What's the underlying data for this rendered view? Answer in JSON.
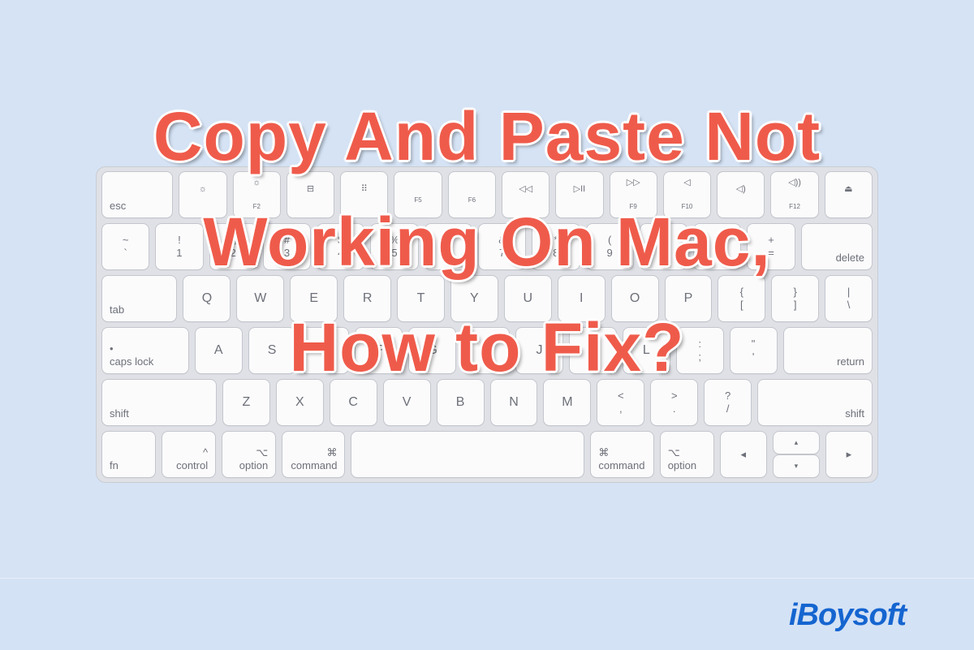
{
  "title": {
    "lines": [
      "Copy And Paste Not",
      "Working On Mac,",
      "How to Fix?"
    ],
    "color": "#ef5b4b"
  },
  "logo": {
    "text": "iBoysoft",
    "color": "#1565d0"
  },
  "background_color": "#d5e3f5",
  "keyboard": {
    "rows": [
      [
        {
          "t": "",
          "b": "esc",
          "cls": "left",
          "w": 1.35
        },
        {
          "t": "☼",
          "b": "",
          "cls": "fn"
        },
        {
          "t": "☼",
          "b": "F2",
          "cls": "fn"
        },
        {
          "t": "⊟",
          "b": "",
          "cls": "fn"
        },
        {
          "t": "⠿",
          "b": "",
          "cls": "fn"
        },
        {
          "t": "",
          "b": "F5",
          "cls": "fn"
        },
        {
          "t": "",
          "b": "F6",
          "cls": "fn"
        },
        {
          "t": "◁◁",
          "b": "",
          "cls": "fn"
        },
        {
          "t": "▷II",
          "b": "",
          "cls": "fn"
        },
        {
          "t": "▷▷",
          "b": "F9",
          "cls": "fn"
        },
        {
          "t": "◁",
          "b": "F10",
          "cls": "fn"
        },
        {
          "t": "◁)",
          "b": "",
          "cls": "fn"
        },
        {
          "t": "◁))",
          "b": "F12",
          "cls": "fn"
        },
        {
          "t": "⏏",
          "b": "",
          "cls": "fn"
        }
      ],
      [
        {
          "t": "~",
          "b": "`"
        },
        {
          "t": "!",
          "b": "1"
        },
        {
          "t": "@",
          "b": "2"
        },
        {
          "t": "#",
          "b": "3"
        },
        {
          "t": "$",
          "b": "4"
        },
        {
          "t": "%",
          "b": "5"
        },
        {
          "t": "^",
          "b": "6"
        },
        {
          "t": "&",
          "b": "7"
        },
        {
          "t": "*",
          "b": "8"
        },
        {
          "t": "(",
          "b": "9"
        },
        {
          "t": ")",
          "b": "0"
        },
        {
          "t": "_",
          "b": "-"
        },
        {
          "t": "+",
          "b": "="
        },
        {
          "t": "",
          "b": "delete",
          "cls": "right",
          "w": 1.35
        }
      ],
      [
        {
          "t": "",
          "b": "tab",
          "cls": "left",
          "w": 1.45
        },
        {
          "t": "Q",
          "cls": "big"
        },
        {
          "t": "W",
          "cls": "big"
        },
        {
          "t": "E",
          "cls": "big"
        },
        {
          "t": "R",
          "cls": "big"
        },
        {
          "t": "T",
          "cls": "big"
        },
        {
          "t": "Y",
          "cls": "big"
        },
        {
          "t": "U",
          "cls": "big"
        },
        {
          "t": "I",
          "cls": "big"
        },
        {
          "t": "O",
          "cls": "big"
        },
        {
          "t": "P",
          "cls": "big"
        },
        {
          "t": "{",
          "b": "["
        },
        {
          "t": "}",
          "b": "]"
        },
        {
          "t": "|",
          "b": "\\"
        }
      ],
      [
        {
          "t": "•",
          "b": "caps lock",
          "cls": "left",
          "w": 1.7
        },
        {
          "t": "A",
          "cls": "big"
        },
        {
          "t": "S",
          "cls": "big"
        },
        {
          "t": "D",
          "cls": "big"
        },
        {
          "t": "F",
          "cls": "big"
        },
        {
          "t": "G",
          "cls": "big"
        },
        {
          "t": "H",
          "cls": "big"
        },
        {
          "t": "J",
          "cls": "big"
        },
        {
          "t": "K",
          "cls": "big"
        },
        {
          "t": "L",
          "cls": "big"
        },
        {
          "t": ":",
          "b": ";"
        },
        {
          "t": "\"",
          "b": "'"
        },
        {
          "t": "",
          "b": "return",
          "cls": "right",
          "w": 1.75
        }
      ],
      [
        {
          "t": "",
          "b": "shift",
          "cls": "left",
          "w": 2.3
        },
        {
          "t": "Z",
          "cls": "big"
        },
        {
          "t": "X",
          "cls": "big"
        },
        {
          "t": "C",
          "cls": "big"
        },
        {
          "t": "V",
          "cls": "big"
        },
        {
          "t": "B",
          "cls": "big"
        },
        {
          "t": "N",
          "cls": "big"
        },
        {
          "t": "M",
          "cls": "big"
        },
        {
          "t": "<",
          "b": ","
        },
        {
          "t": ">",
          "b": "."
        },
        {
          "t": "?",
          "b": "/"
        },
        {
          "t": "",
          "b": "shift",
          "cls": "right",
          "w": 2.3
        }
      ],
      [
        {
          "t": "",
          "b": "fn",
          "cls": "left"
        },
        {
          "t": "^",
          "b": "control",
          "cls": "right"
        },
        {
          "t": "⌥",
          "b": "option",
          "cls": "right"
        },
        {
          "t": "⌘",
          "b": "command",
          "cls": "right",
          "w": 1.2
        },
        {
          "t": "",
          "b": "",
          "w": 5.1
        },
        {
          "t": "⌘",
          "b": "command",
          "cls": "left",
          "w": 1.2
        },
        {
          "t": "⌥",
          "b": "option",
          "cls": "left"
        },
        {
          "t": "◂",
          "b": ""
        },
        {
          "arrows": [
            "▴",
            "▾"
          ]
        },
        {
          "t": "▸",
          "b": ""
        }
      ]
    ]
  }
}
